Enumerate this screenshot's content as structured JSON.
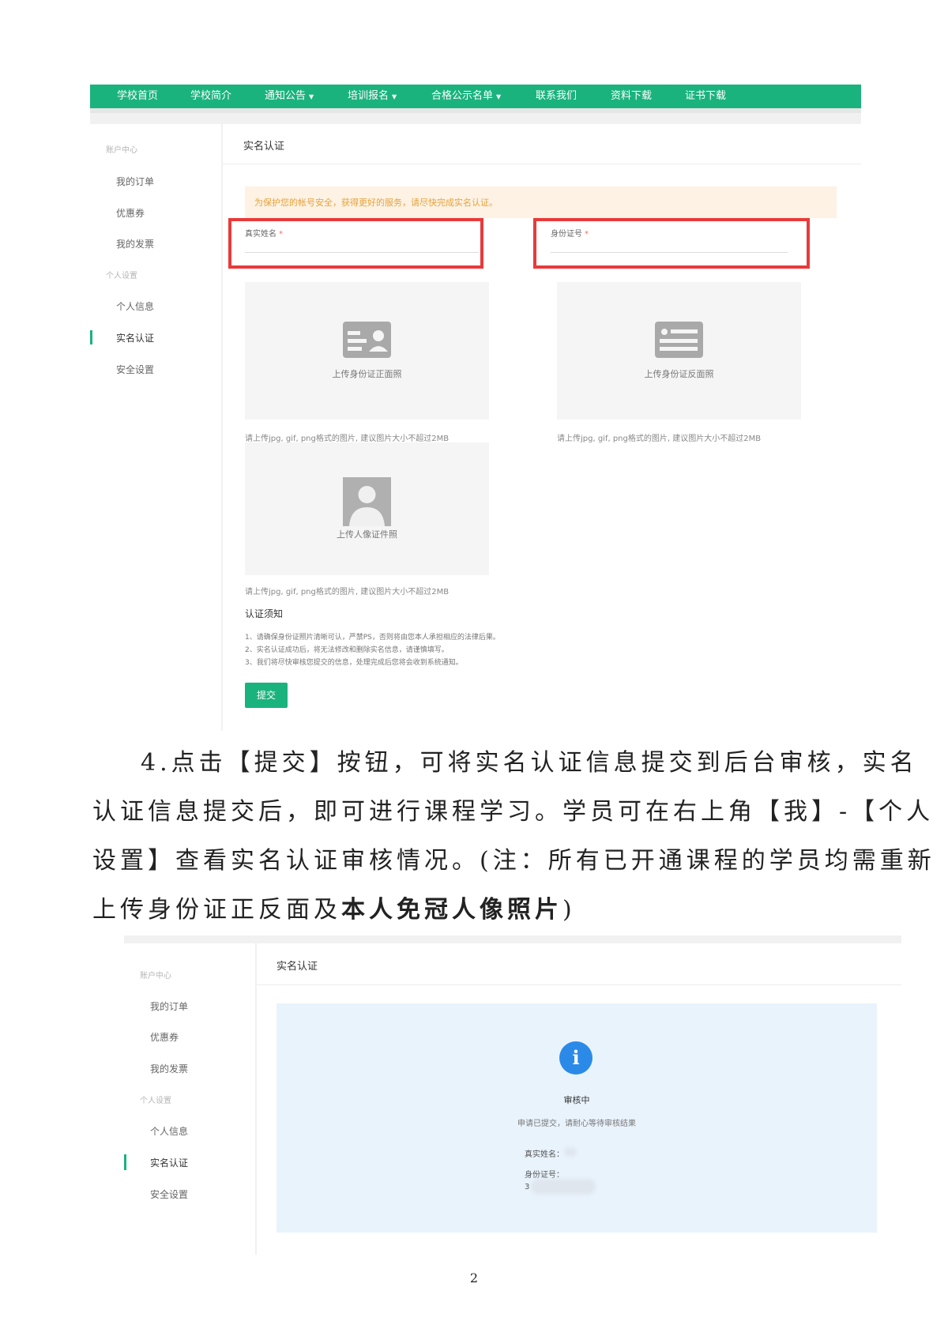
{
  "screenshot1": {
    "nav": [
      {
        "label": "学校首页",
        "dropdown": false
      },
      {
        "label": "学校简介",
        "dropdown": false
      },
      {
        "label": "通知公告",
        "dropdown": true
      },
      {
        "label": "培训报名",
        "dropdown": true
      },
      {
        "label": "合格公示名单",
        "dropdown": true
      },
      {
        "label": "联系我们",
        "dropdown": false
      },
      {
        "label": "资料下载",
        "dropdown": false
      },
      {
        "label": "证书下载",
        "dropdown": false
      }
    ],
    "nav_caret": "▼",
    "sidebar": {
      "group_account": "账户中心",
      "my_orders": "我的订单",
      "coupons": "优惠券",
      "my_invoices": "我的发票",
      "group_personal": "个人设置",
      "personal_info": "个人信息",
      "real_name": "实名认证",
      "security": "安全设置"
    },
    "card_title": "实名认证",
    "notice": "为保护您的帐号安全，获得更好的服务，请尽快完成实名认证。",
    "real_name_label": "真实姓名",
    "id_number_label": "身份证号",
    "required_mark": "*",
    "upload_front": "上传身份证正面照",
    "upload_back": "上传身份证反面照",
    "upload_portrait": "上传人像证件照",
    "upload_hint": "请上传jpg, gif, png格式的图片, 建议图片大小不超过2MB",
    "rules_title": "认证须知",
    "rules": [
      "1、请确保身份证照片清晰可认，严禁PS，否则将由您本人承担相应的法律后果。",
      "2、实名认证成功后，将无法修改和删除实名信息，请谨慎填写。",
      "3、我们将尽快审核您提交的信息，处理完成后您将会收到系统通知。"
    ],
    "submit_label": "提交",
    "accent_color": "#1ab37e",
    "highlight_color": "#e83a3a"
  },
  "paragraph": {
    "line1": "4.点击【提交】按钮，可将实名认证信息提交到后台审核，实名",
    "line2": "认证信息提交后，即可进行课程学习。学员可在右上角【我】-【个人",
    "line3": "设置】查看实名认证审核情况。(注：所有已开通课程的学员均需重新",
    "line4_plain": "上传身份证正反面及",
    "line4_bold": "本人免冠人像照片",
    "line4_end": ")"
  },
  "screenshot2": {
    "sidebar": {
      "group_account": "账户中心",
      "my_orders": "我的订单",
      "coupons": "优惠券",
      "my_invoices": "我的发票",
      "group_personal": "个人设置",
      "personal_info": "个人信息",
      "real_name": "实名认证",
      "security": "安全设置"
    },
    "card_title": "实名认证",
    "info_icon": "i",
    "status_title": "审核中",
    "status_desc": "申请已提交，请耐心等待审核结果",
    "name_label": "真实姓名：",
    "id_label": "身份证号：",
    "id_first_char": "3"
  },
  "page_number": "2"
}
